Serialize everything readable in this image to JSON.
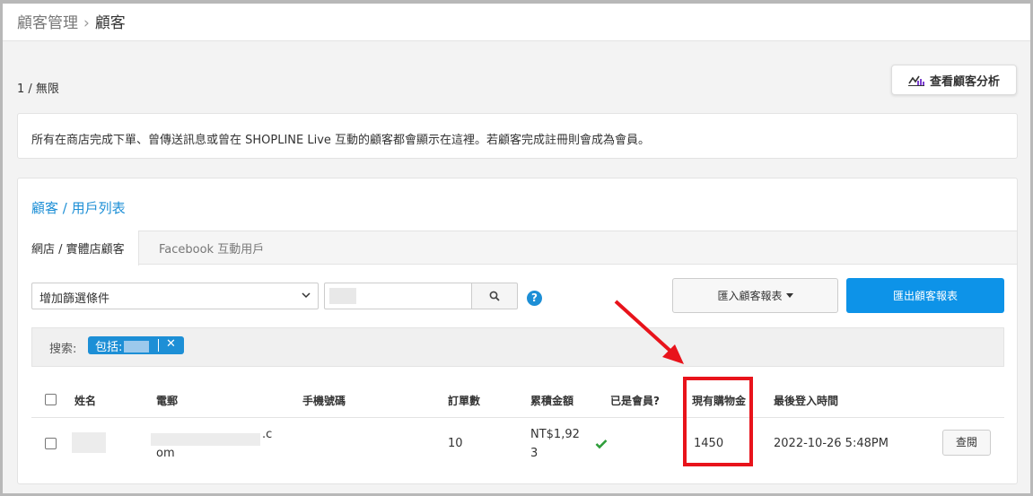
{
  "breadcrumb": {
    "parent": "顧客管理",
    "separator": "›",
    "current": "顧客"
  },
  "count_text": "1 / 無限",
  "analysis_button": {
    "label": "查看顧客分析",
    "icon": "chart-icon"
  },
  "info_text": "所有在商店完成下單、曾傳送訊息或曾在 SHOPLINE Live 互動的顧客都會顯示在這裡。若顧客完成註冊則會成為會員。",
  "panel": {
    "title": "顧客 / 用戶列表",
    "tabs": [
      {
        "label": "網店 / 實體店顧客",
        "active": true
      },
      {
        "label": "Facebook 互動用戶",
        "active": false
      }
    ],
    "filter": {
      "selected": "增加篩選條件"
    },
    "search": {
      "value": ""
    },
    "help_icon_text": "?",
    "import_button": "匯入顧客報表",
    "export_button": "匯出顧客報表",
    "search_label": "搜索:",
    "tag": {
      "label": "包括:",
      "close": "✕"
    }
  },
  "table": {
    "columns": [
      "姓名",
      "電郵",
      "手機號碼",
      "訂單數",
      "累積金額",
      "已是會員?",
      "現有購物金",
      "最後登入時間"
    ],
    "rows": [
      {
        "name": "",
        "email_suffix": ".c",
        "email_line2": "om",
        "phone": "",
        "orders": "10",
        "amount_line1": "NT$1,92",
        "amount_line2": "3",
        "is_member": true,
        "credit": "1450",
        "last_login": "2022-10-26 5:48PM",
        "action": "查閱"
      }
    ]
  },
  "colors": {
    "accent": "#1d8fd6",
    "export_button": "#0d93e8",
    "annotation": "#e8131b",
    "member_check": "#2e9e3a"
  }
}
